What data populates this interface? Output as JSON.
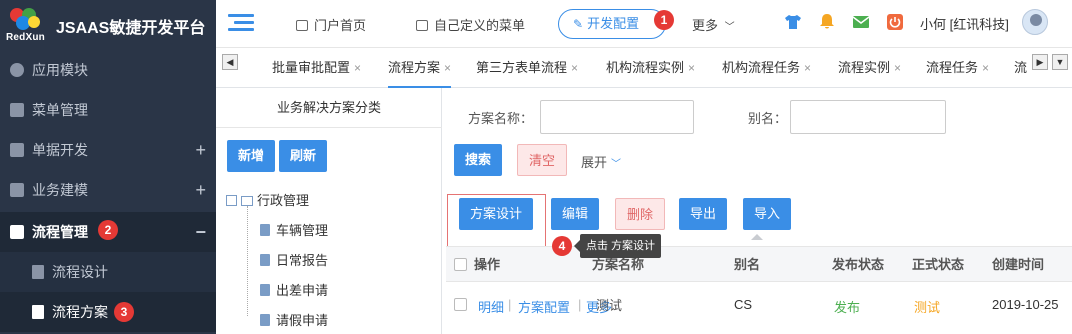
{
  "brand": {
    "logo_text": "RedXun",
    "title": "JSAAS敏捷开发平台"
  },
  "header": {
    "nav": [
      {
        "label": "门户首页"
      },
      {
        "label": "自己定义的菜单"
      }
    ],
    "dev_config": "开发配置",
    "more": "更多",
    "user": "小何 [红讯科技]",
    "icons": [
      "tshirt-icon",
      "bell-icon",
      "mail-icon",
      "power-icon"
    ],
    "icon_colors": {
      "tshirt": "#3a8ee6",
      "bell": "#f5a623",
      "mail": "#4caf50",
      "power": "#f06a3e"
    }
  },
  "sidebar": {
    "items": [
      {
        "label": "应用模块",
        "icon": "module-icon"
      },
      {
        "label": "菜单管理",
        "icon": "grid-icon"
      },
      {
        "label": "单据开发",
        "icon": "form-icon",
        "expand": "+"
      },
      {
        "label": "业务建模",
        "icon": "cube-icon",
        "expand": "+"
      },
      {
        "label": "流程管理",
        "icon": "flow-icon",
        "expand": "−"
      }
    ],
    "sub_items": [
      {
        "label": "流程设计",
        "icon": "doc-icon"
      },
      {
        "label": "流程方案",
        "icon": "cube-icon"
      }
    ]
  },
  "tabs": {
    "items": [
      "批量审批配置",
      "流程方案",
      "第三方表单流程",
      "机构流程实例",
      "机构流程任务",
      "流程实例",
      "流程任务",
      "流"
    ],
    "close": "×",
    "arrow_left": "◀",
    "arrow_down": "▼"
  },
  "tree": {
    "title": "业务解决方案分类",
    "add_button": "新增",
    "refresh_button": "刷新",
    "root": "行政管理",
    "leaves": [
      "车辆管理",
      "日常报告",
      "出差申请",
      "请假申请"
    ]
  },
  "search": {
    "name_label": "方案名称：",
    "name_value": "",
    "alias_label": "别名：",
    "alias_value": "",
    "search_button": "搜索",
    "clear_button": "清空",
    "expand_label": "展开"
  },
  "toolbar": {
    "design": "方案设计",
    "edit": "编辑",
    "delete": "删除",
    "export": "导出",
    "import": "导入"
  },
  "tooltip": {
    "text": "点击 方案设计"
  },
  "steps": [
    "1",
    "2",
    "3",
    "4"
  ],
  "table": {
    "columns": [
      "操作",
      "方案名称",
      "别名",
      "发布状态",
      "正式状态",
      "创建时间"
    ],
    "rows": [
      {
        "actions": [
          "明细",
          "方案配置",
          "更多"
        ],
        "name": "测试",
        "alias": "CS",
        "publish_status": "发布",
        "formal_status": "测试",
        "created": "2019-10-25"
      }
    ]
  },
  "colors": {
    "accent": "#3a8ee6",
    "sidebar": "#2a3547",
    "badge": "#e53935",
    "publish": "#4caf50",
    "test": "#f5a623"
  }
}
